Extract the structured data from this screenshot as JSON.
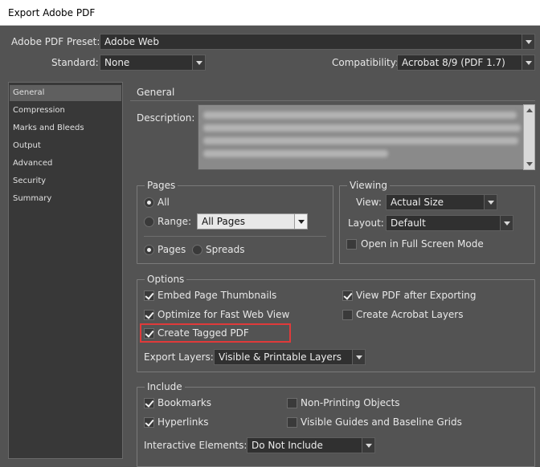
{
  "window": {
    "title": "Export Adobe PDF"
  },
  "preset": {
    "label": "Adobe PDF Preset:",
    "value": "Adobe Web"
  },
  "standard": {
    "label": "Standard:",
    "value": "None"
  },
  "compatibility": {
    "label": "Compatibility:",
    "value": "Acrobat 8/9 (PDF 1.7)"
  },
  "sidebar": {
    "items": [
      {
        "label": "General",
        "selected": true
      },
      {
        "label": "Compression"
      },
      {
        "label": "Marks and Bleeds"
      },
      {
        "label": "Output"
      },
      {
        "label": "Advanced"
      },
      {
        "label": "Security"
      },
      {
        "label": "Summary"
      }
    ]
  },
  "main": {
    "section_title": "General",
    "description_label": "Description:"
  },
  "pages": {
    "title": "Pages",
    "all_label": "All",
    "range_label": "Range:",
    "range_value": "All Pages",
    "pages_label": "Pages",
    "spreads_label": "Spreads"
  },
  "viewing": {
    "title": "Viewing",
    "view_label": "View:",
    "view_value": "Actual Size",
    "layout_label": "Layout:",
    "layout_value": "Default",
    "fullscreen_label": "Open in Full Screen Mode"
  },
  "options": {
    "title": "Options",
    "embed_thumbnails": "Embed Page Thumbnails",
    "optimize_web": "Optimize for Fast Web View",
    "create_tagged": "Create Tagged PDF",
    "view_after": "View PDF after Exporting",
    "acrobat_layers": "Create Acrobat Layers",
    "export_layers_label": "Export Layers:",
    "export_layers_value": "Visible & Printable Layers"
  },
  "include": {
    "title": "Include",
    "bookmarks": "Bookmarks",
    "hyperlinks": "Hyperlinks",
    "non_printing": "Non-Printing Objects",
    "visible_guides": "Visible Guides and Baseline Grids",
    "interactive_label": "Interactive Elements:",
    "interactive_value": "Do Not Include"
  }
}
